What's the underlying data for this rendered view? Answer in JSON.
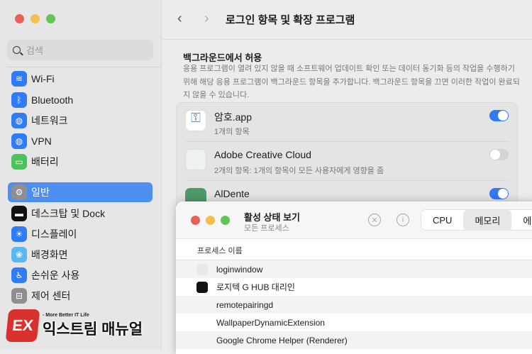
{
  "sidebar": {
    "search_placeholder": "검색",
    "items": [
      {
        "label": "Wi-Fi",
        "color": "#2f7cf6"
      },
      {
        "label": "Bluetooth",
        "color": "#2f7cf6"
      },
      {
        "label": "네트워크",
        "color": "#2f7cf6"
      },
      {
        "label": "VPN",
        "color": "#2f7cf6"
      },
      {
        "label": "배터리",
        "color": "#4cc35a"
      },
      {
        "label": "일반",
        "color": "#8e8e93"
      },
      {
        "label": "데스크탑 및 Dock",
        "color": "#111111"
      },
      {
        "label": "디스플레이",
        "color": "#2f7cf6"
      },
      {
        "label": "배경화면",
        "color": "#5ab8f0"
      },
      {
        "label": "손쉬운 사용",
        "color": "#2f7cf6"
      },
      {
        "label": "제어 센터",
        "color": "#8e8e93"
      }
    ]
  },
  "header": {
    "title": "로그인 항목 및 확장 프로그램",
    "back": "‹",
    "forward": "›"
  },
  "section": {
    "title": "백그라운드에서 허용",
    "description": "응용 프로그램이 열려 있지 않을 때 소프트웨어 업데이트 확인 또는 데이터 동기화 등의 작업을 수행하기 위해 해당 응용 프로그램이 백그라운드 항목을 추가합니다. 백그라운드 항목을 끄면 이러한 작업이 완료되지 않을 수 있습니다.",
    "apps": [
      {
        "name": "암호.app",
        "sub": "1개의 항목",
        "on": true
      },
      {
        "name": "Adobe Creative Cloud",
        "sub": "2개의 항목: 1개의 항목이 모든 사용자에게 영향을 줌",
        "on": false
      },
      {
        "name": "AlDente",
        "sub": "",
        "on": true
      }
    ]
  },
  "activity_monitor": {
    "title": "활성 상태 보기",
    "subtitle": "모든 프로세스",
    "tabs": [
      "CPU",
      "메모리",
      "에"
    ],
    "column": "프로세스 이름",
    "processes": [
      "loginwindow",
      "로지텍 G HUB 대리인",
      "remotepairingd",
      "WallpaperDynamicExtension",
      "Google Chrome Helper (Renderer)"
    ]
  },
  "watermark": {
    "logo": "EX",
    "tagline": "- More Better IT Life",
    "name": "익스트림 매뉴얼"
  }
}
